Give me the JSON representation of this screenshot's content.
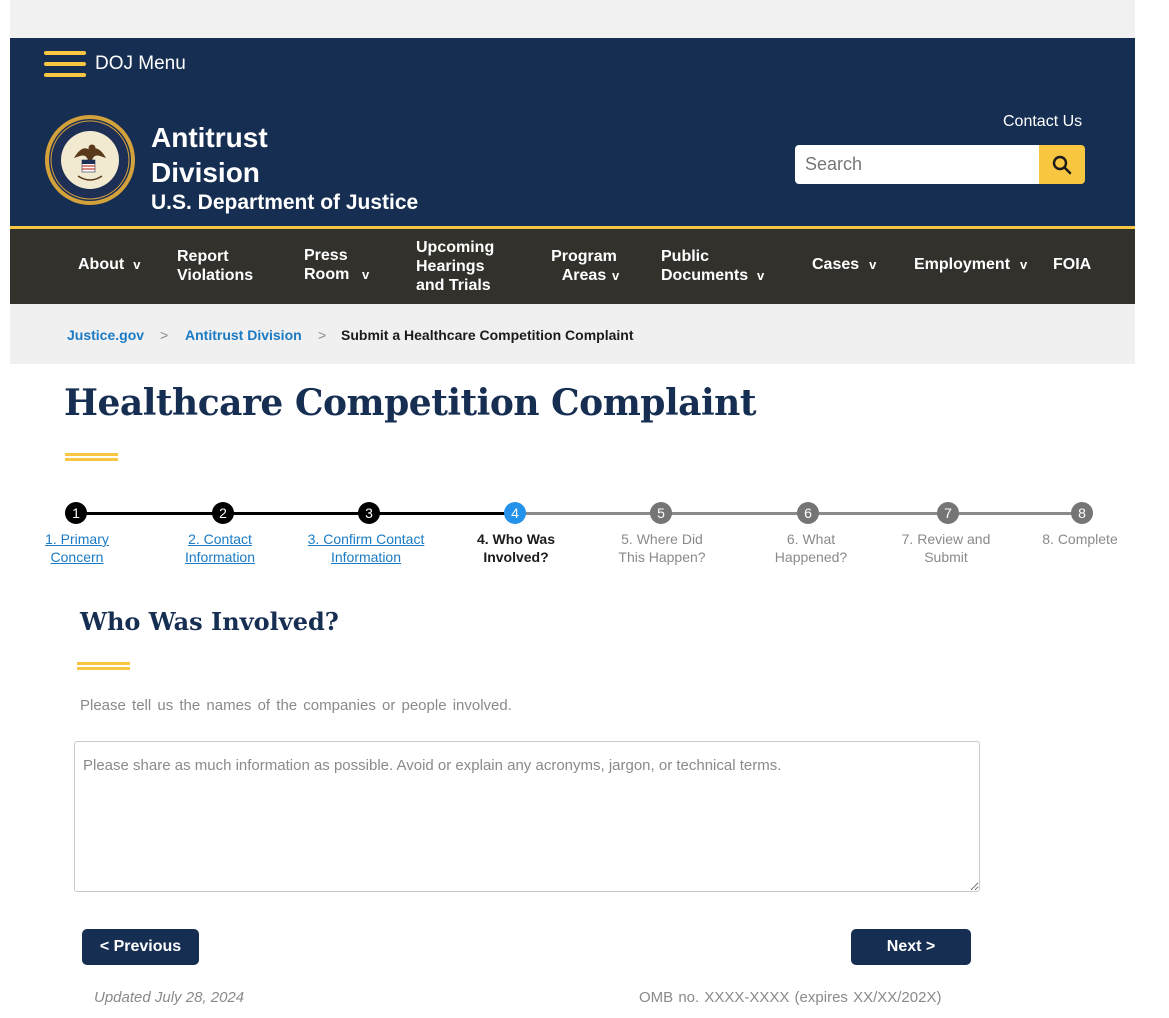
{
  "header": {
    "menu_label": "DOJ Menu",
    "title_line1": "Antitrust",
    "title_line2": "Division",
    "subtitle": "U.S. Department of Justice",
    "contact_label": "Contact Us",
    "search_placeholder": "Search"
  },
  "nav": {
    "items": [
      {
        "label": "About",
        "has_caret": true
      },
      {
        "label": "Report Violations",
        "has_caret": false
      },
      {
        "label": "Press Room",
        "has_caret": true
      },
      {
        "label": "Upcoming Hearings and Trials",
        "has_caret": false
      },
      {
        "label": "Program Areas",
        "has_caret": true
      },
      {
        "label": "Public Documents",
        "has_caret": true
      },
      {
        "label": "Cases",
        "has_caret": true
      },
      {
        "label": "Employment",
        "has_caret": true
      },
      {
        "label": "FOIA",
        "has_caret": false
      }
    ],
    "caret": "v"
  },
  "breadcrumb": {
    "items": [
      "Justice.gov",
      "Antitrust Division",
      "Submit a Healthcare Competition Complaint"
    ],
    "separator": ">"
  },
  "page": {
    "title": "Healthcare Competition Complaint"
  },
  "steps": [
    {
      "number": "1",
      "label": "1. Primary Concern",
      "state": "done"
    },
    {
      "number": "2",
      "label": "2. Contact Information",
      "state": "done"
    },
    {
      "number": "3",
      "label": "3. Confirm Contact Information",
      "state": "done"
    },
    {
      "number": "4",
      "label": "4. Who Was Involved?",
      "state": "current"
    },
    {
      "number": "5",
      "label": "5. Where Did This Happen?",
      "state": "future"
    },
    {
      "number": "6",
      "label": "6. What Happened?",
      "state": "future"
    },
    {
      "number": "7",
      "label": "7. Review and Submit",
      "state": "future"
    },
    {
      "number": "8",
      "label": "8. Complete",
      "state": "future"
    }
  ],
  "form": {
    "section_title": "Who Was Involved?",
    "instructions": "Please tell us the names of the companies or people involved.",
    "textarea_placeholder": "Please share as much information as possible. Avoid or explain any acronyms, jargon, or technical terms.",
    "textarea_value": "",
    "previous_label": "< Previous",
    "next_label": "Next >"
  },
  "footer": {
    "updated": "Updated July 28, 2024",
    "omb": "OMB no. XXXX-XXXX (expires XX/XX/202X)"
  },
  "colors": {
    "navy": "#162e51",
    "gold": "#f9c642",
    "nav_bg": "#32312c",
    "link_blue": "#1a7bc4",
    "current_step": "#2491eb",
    "future_step": "#757575"
  },
  "icons": {
    "menu": "hamburger-icon",
    "search": "magnifying-glass-icon",
    "seal": "doj-seal-logo"
  }
}
